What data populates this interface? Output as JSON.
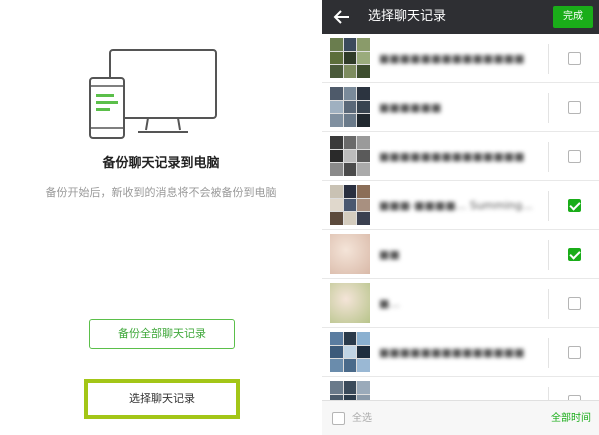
{
  "left": {
    "title": "备份聊天记录到电脑",
    "subtitle": "备份开始后，新收到的消息将不会被备份到电脑",
    "backup_all_button": "备份全部聊天记录",
    "select_button": "选择聊天记录"
  },
  "right": {
    "header": {
      "title": "选择聊天记录",
      "done_label": "完成"
    },
    "chats": [
      {
        "name": "■■■■■■■■■■■■■■",
        "blurred": true,
        "checked": false,
        "avatar": "grid",
        "palette": [
          "#6a7d4e",
          "#3b4a5c",
          "#8a9b6a",
          "#5c6e3a",
          "#2f3b28",
          "#9aab7c",
          "#4a5a3a",
          "#7d8c5f",
          "#3d4d2e"
        ]
      },
      {
        "name": "■■■■■■",
        "blurred": true,
        "checked": false,
        "avatar": "grid",
        "palette": [
          "#4e5a6a",
          "#7a8a9a",
          "#2c3440",
          "#9fb0c0",
          "#5a6878",
          "#384450",
          "#8090a0",
          "#6a7a8a",
          "#20282f"
        ]
      },
      {
        "name": "■■■■■■■■■■■■■■",
        "blurred": true,
        "checked": false,
        "avatar": "grid",
        "palette": [
          "#3a3a3a",
          "#6a6a6a",
          "#9a9a9a",
          "#2a2a2a",
          "#bcbcbc",
          "#5a5a5a",
          "#8a8a8a",
          "#4a4a4a",
          "#aaaaaa"
        ]
      },
      {
        "name": "■■■-■■■■... Summing...",
        "blurred": true,
        "checked": true,
        "avatar": "grid",
        "palette": [
          "#c9c2b4",
          "#2a3040",
          "#8b6e58",
          "#e0d8cc",
          "#4a5870",
          "#a89080",
          "#5c4a3c",
          "#d4ccbe",
          "#3a4050"
        ]
      },
      {
        "name": "■■",
        "blurred": true,
        "checked": true,
        "avatar": "single",
        "palette": [
          "#d9b9a8"
        ]
      },
      {
        "name": "■...",
        "blurred": true,
        "checked": false,
        "avatar": "single",
        "palette": [
          "#b7c48a"
        ]
      },
      {
        "name": "■■■■■■■■■■■■■■",
        "blurred": true,
        "checked": false,
        "avatar": "grid",
        "palette": [
          "#5a7ca0",
          "#2a3a4a",
          "#8ab0d0",
          "#3c5a7a",
          "#c0d4e4",
          "#1e2e3e",
          "#6a8cac",
          "#4a6a8a",
          "#9ab8d4"
        ]
      },
      {
        "name": "",
        "blurred": true,
        "checked": false,
        "avatar": "grid",
        "palette": [
          "#6a7a8a",
          "#3a4a5a",
          "#9aaaba",
          "#4a5a6a",
          "#2a3a4a",
          "#8a9aaa",
          "#5a6a7a",
          "#7a8a9a",
          "#1a2a3a"
        ]
      }
    ],
    "footer": {
      "select_all_label": "全选",
      "time_filter_label": "全部时间"
    }
  },
  "colors": {
    "accent_green": "#1aad19",
    "highlight_frame": "#a3c617",
    "topbar_bg": "#2e2f33"
  }
}
